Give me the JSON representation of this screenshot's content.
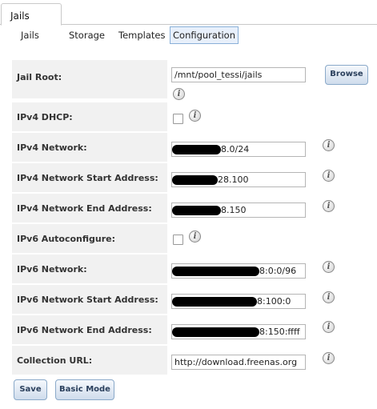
{
  "top_tab": {
    "label": "Jails"
  },
  "sub_tabs": [
    {
      "label": "Jails"
    },
    {
      "label": "Storage"
    },
    {
      "label": "Templates"
    },
    {
      "label": "Configuration"
    }
  ],
  "form": {
    "jail_root": {
      "label": "Jail Root:",
      "value": "/mnt/pool_tessi/jails"
    },
    "ipv4_dhcp": {
      "label": "IPv4 DHCP:",
      "checked": false
    },
    "ipv4_network": {
      "label": "IPv4 Network:",
      "value_visible": "8.0/24"
    },
    "ipv4_start": {
      "label": "IPv4 Network Start Address:",
      "value_visible": "28.100"
    },
    "ipv4_end": {
      "label": "IPv4 Network End Address:",
      "value_visible": "8.150"
    },
    "ipv6_autoconf": {
      "label": "IPv6 Autoconfigure:",
      "checked": false
    },
    "ipv6_network": {
      "label": "IPv6 Network:",
      "value_visible": "8:0:0/96"
    },
    "ipv6_start": {
      "label": "IPv6 Network Start Address:",
      "value_visible": "8:100:0"
    },
    "ipv6_end": {
      "label": "IPv6 Network End Address:",
      "value_visible": "8:150:ffff"
    },
    "collection_url": {
      "label": "Collection URL:",
      "value": "http://download.freenas.org"
    }
  },
  "buttons": {
    "browse": "Browse",
    "save": "Save",
    "basic_mode": "Basic Mode"
  },
  "info_glyph": "i",
  "icons": [
    "info-icon"
  ]
}
